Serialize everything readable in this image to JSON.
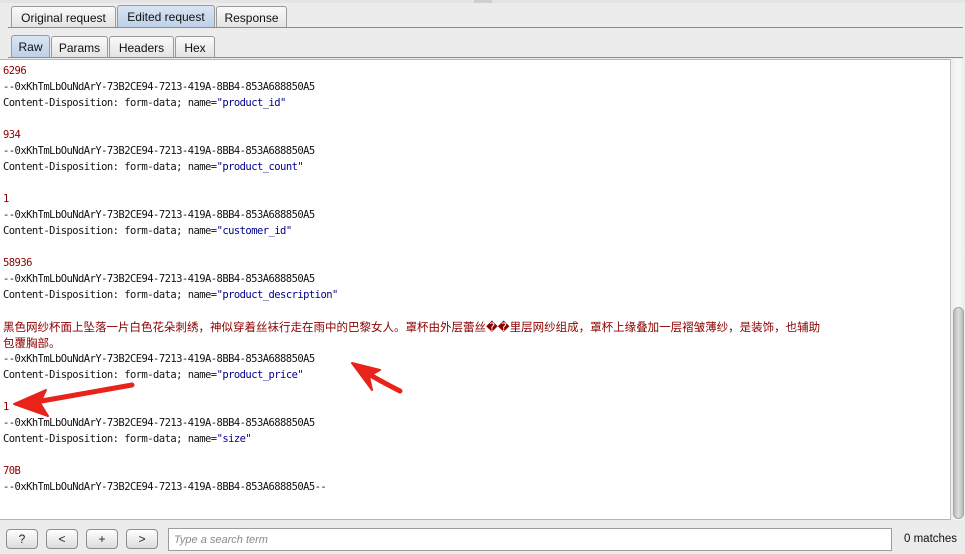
{
  "request_tabs": [
    {
      "label": "Original request",
      "active": false
    },
    {
      "label": "Edited request",
      "active": true
    },
    {
      "label": "Response",
      "active": false
    }
  ],
  "view_tabs": [
    {
      "label": "Raw",
      "active": true
    },
    {
      "label": "Params",
      "active": false
    },
    {
      "label": "Headers",
      "active": false
    },
    {
      "label": "Hex",
      "active": false
    }
  ],
  "body": {
    "l01": "6296",
    "l02": "--0xKhTmLbOuNdArY-73B2CE94-7213-419A-8BB4-853A688850A5",
    "l03_prefix": "Content-Disposition: form-data; name=",
    "l03_name": "\"product_id\"",
    "l04": "",
    "l05": "934",
    "l06": "--0xKhTmLbOuNdArY-73B2CE94-7213-419A-8BB4-853A688850A5",
    "l07_prefix": "Content-Disposition: form-data; name=",
    "l07_name": "\"product_count\"",
    "l08": "",
    "l09": "1",
    "l10": "--0xKhTmLbOuNdArY-73B2CE94-7213-419A-8BB4-853A688850A5",
    "l11_prefix": "Content-Disposition: form-data; name=",
    "l11_name": "\"customer_id\"",
    "l12": "",
    "l13": "58936",
    "l14": "--0xKhTmLbOuNdArY-73B2CE94-7213-419A-8BB4-853A688850A5",
    "l15_prefix": "Content-Disposition: form-data; name=",
    "l15_name": "\"product_description\"",
    "l16": "",
    "l17": "黑色网纱杯面上坠落一片白色花朵刺绣，神似穿着丝袜行走在雨中的巴黎女人。罩杯由外层蕾丝��里层网纱组成，罩杯上缘叠加一层褶皱薄纱，是装饰，也辅助",
    "l18": "包覆胸部。",
    "l19": "--0xKhTmLbOuNdArY-73B2CE94-7213-419A-8BB4-853A688850A5",
    "l20_prefix": "Content-Disposition: form-data; name=",
    "l20_name": "\"product_price\"",
    "l21": "",
    "l22": "1",
    "l23": "--0xKhTmLbOuNdArY-73B2CE94-7213-419A-8BB4-853A688850A5",
    "l24_prefix": "Content-Disposition: form-data; name=",
    "l24_name": "\"size\"",
    "l25": "",
    "l26": "70B",
    "l27": "--0xKhTmLbOuNdArY-73B2CE94-7213-419A-8BB4-853A688850A5--"
  },
  "search": {
    "help_label": "?",
    "prev_label": "<",
    "add_label": "+",
    "next_label": ">",
    "placeholder": "Type a search term",
    "matches": "0 matches"
  },
  "colors": {
    "value_text": "#8b0000",
    "param_name": "#00008b",
    "annotation_arrow": "#e8231a",
    "active_tab": "#c6d7ea"
  },
  "icons": [
    "red-arrow-annotation-icon",
    "red-arrow-annotation-icon"
  ]
}
